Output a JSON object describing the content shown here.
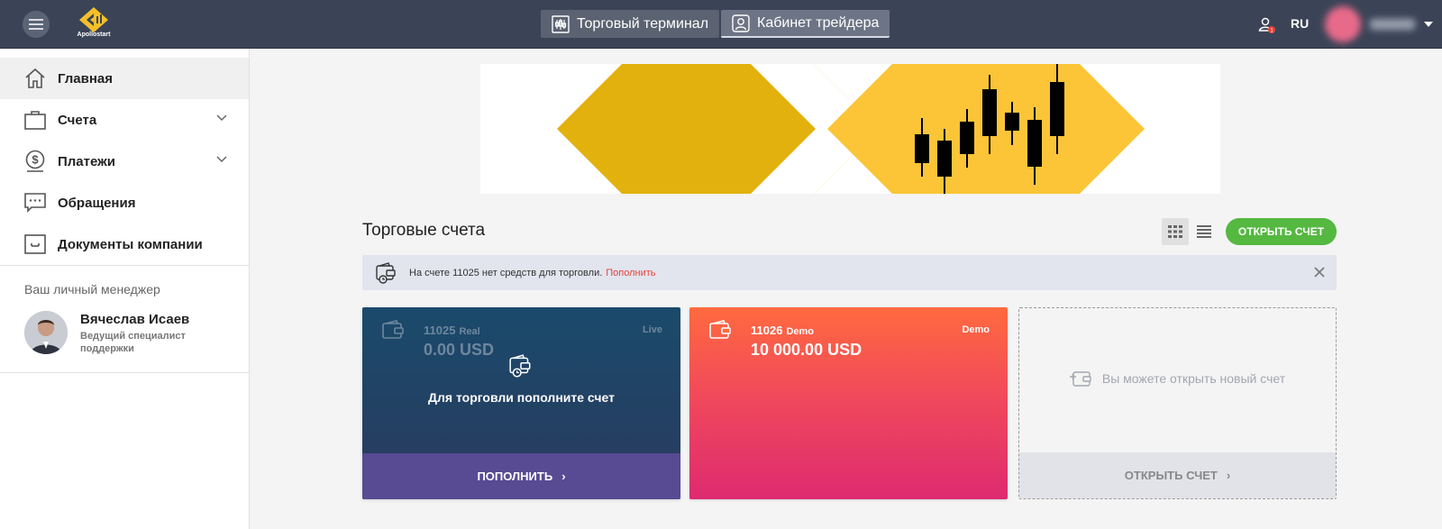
{
  "app": {
    "logo_text": "Apollostart"
  },
  "topbar": {
    "tabs": [
      {
        "label": "Торговый терминал",
        "active": false
      },
      {
        "label": "Кабинет трейдера",
        "active": true
      }
    ],
    "language": "RU",
    "notification_count": "1"
  },
  "sidebar": {
    "items": [
      {
        "label": "Главная",
        "icon": "home-icon",
        "active": true
      },
      {
        "label": "Счета",
        "icon": "briefcase-icon",
        "has_submenu": true
      },
      {
        "label": "Платежи",
        "icon": "dollar-circle-icon",
        "has_submenu": true
      },
      {
        "label": "Обращения",
        "icon": "chat-icon"
      },
      {
        "label": "Документы компании",
        "icon": "document-box-icon"
      }
    ],
    "manager": {
      "title": "Ваш личный менеджер",
      "name": "Вячеслав Исаев",
      "role": "Ведущий специалист поддержки"
    }
  },
  "accounts": {
    "title": "Торговые счета",
    "open_button": "ОТКРЫТЬ СЧЕТ",
    "alert": {
      "text": "На счете 11025 нет средств для торговли.",
      "link": "Пополнить"
    },
    "cards": [
      {
        "number": "11025",
        "type": "Real",
        "tag": "Live",
        "balance": "0.00 USD",
        "message": "Для торговли пополните счет",
        "action": "ПОПОЛНИТЬ"
      },
      {
        "number": "11026",
        "type": "Demo",
        "tag": "Demo",
        "balance": "10 000.00 USD"
      }
    ],
    "new_card": {
      "message": "Вы можете открыть новый счет",
      "action": "ОТКРЫТЬ СЧЕТ"
    }
  },
  "colors": {
    "topbar": "#3b4457",
    "accent_green": "#55b840",
    "real_card": "#1a4a6b",
    "demo_card": "#f14a5a",
    "link_red": "#e8433a",
    "banner_yellow": "#f4c02a"
  }
}
